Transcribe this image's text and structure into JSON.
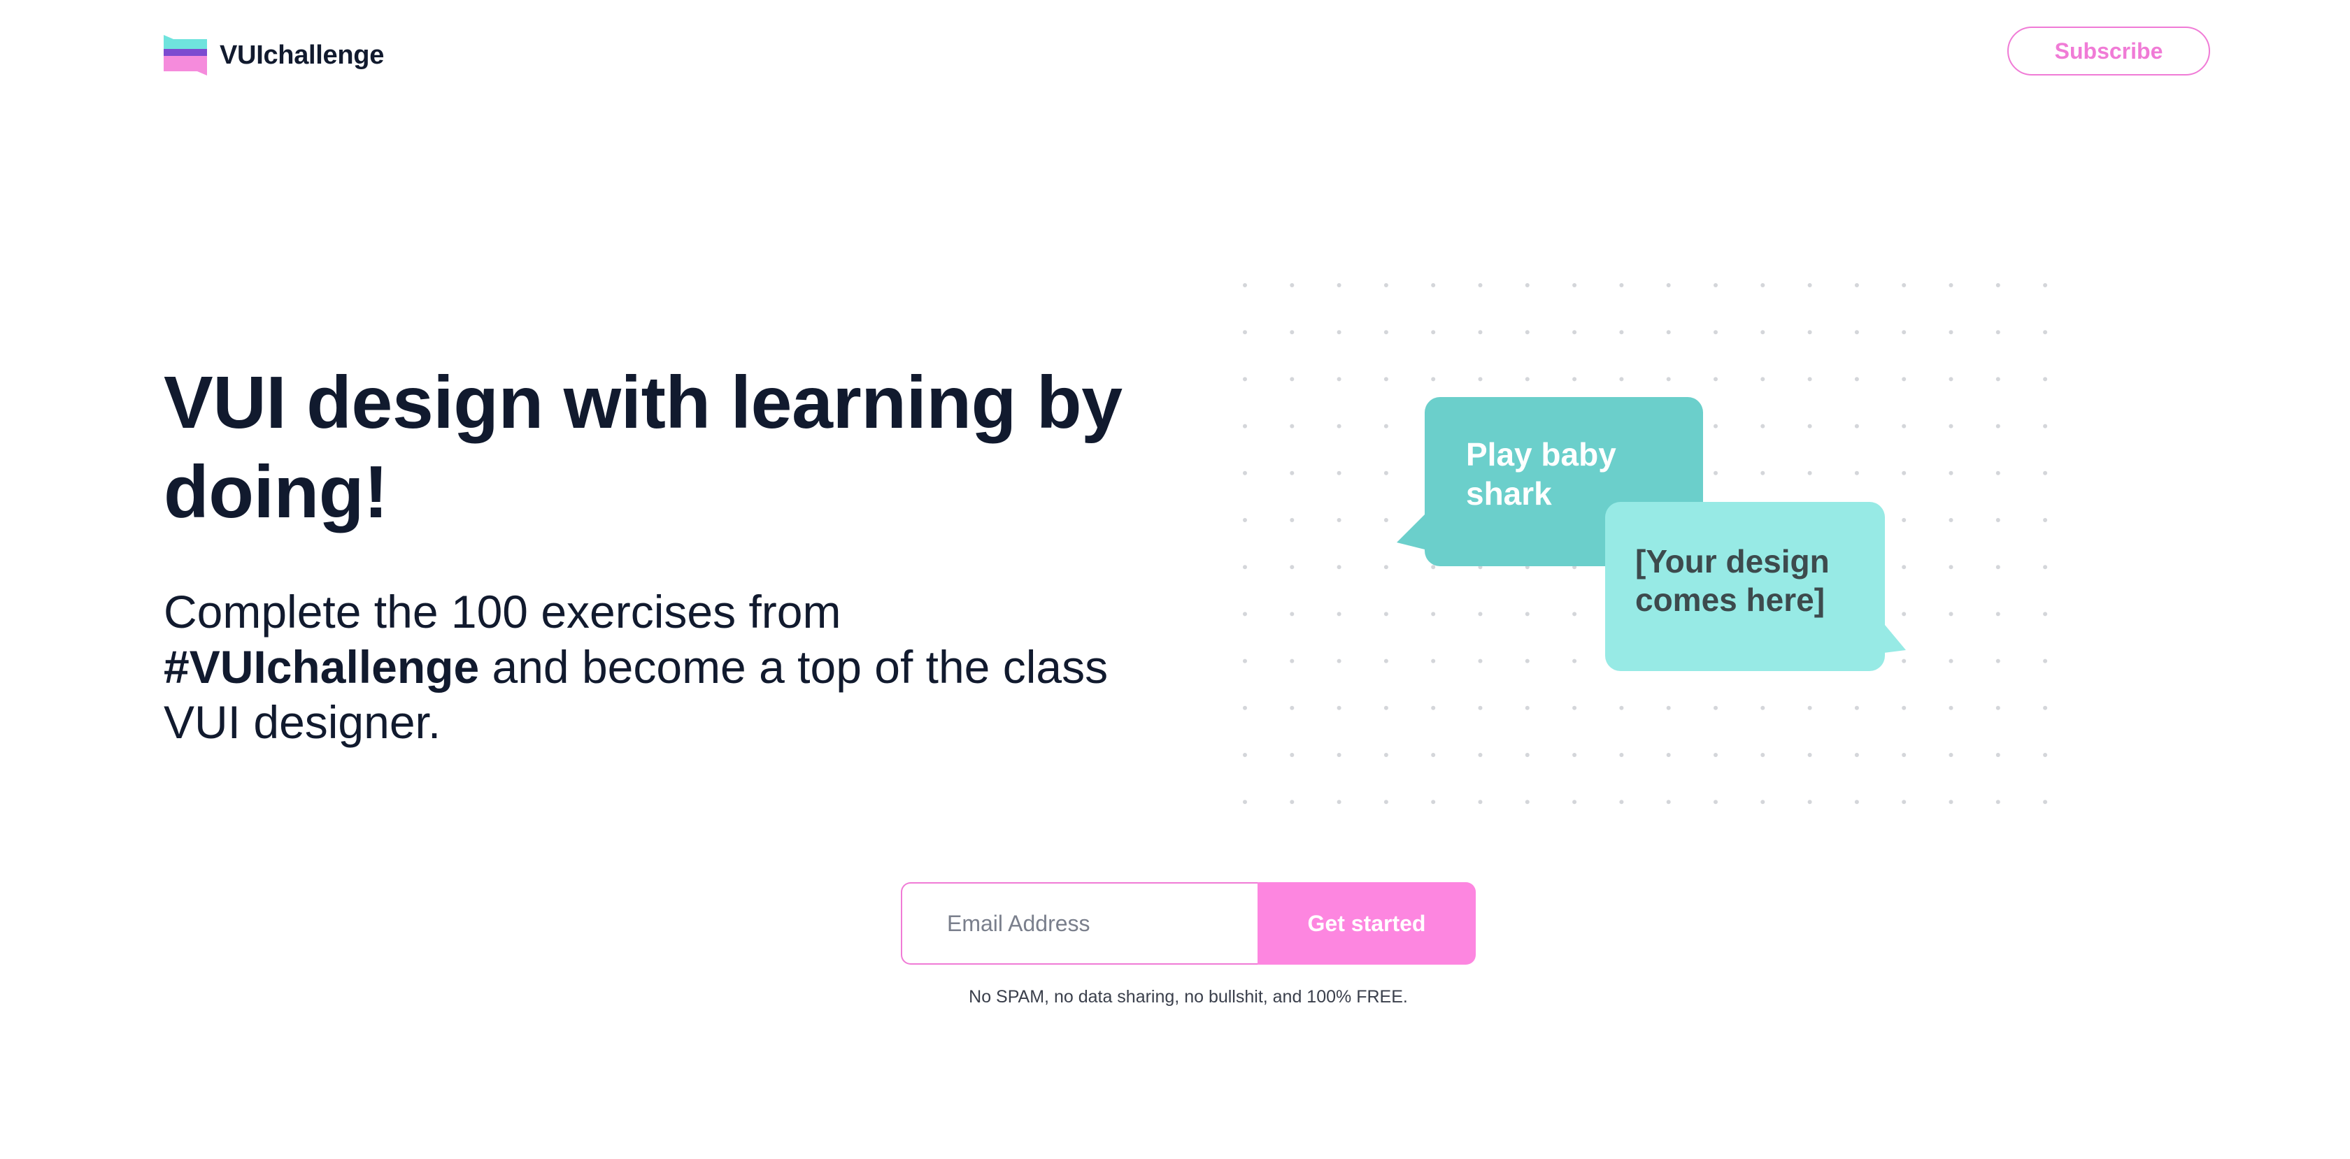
{
  "header": {
    "brand": "VUIchallenge",
    "subscribe_label": "Subscribe"
  },
  "hero": {
    "title": "VUI design with learning by doing!",
    "subtitle_before": "Complete the 100 exercises from ",
    "subtitle_bold": "#VUIchallenge",
    "subtitle_after": " and become a top of the class VUI designer."
  },
  "illustration": {
    "bubble_user_line1": "Play baby",
    "bubble_user_line2": "shark",
    "bubble_reply_line1": "[Your design",
    "bubble_reply_line2": "comes here]"
  },
  "signup": {
    "email_placeholder": "Email Address",
    "email_value": "",
    "cta_label": "Get started",
    "disclaimer": "No SPAM, no data sharing, no bullshit, and 100% FREE."
  },
  "colors": {
    "accent_pink": "#fd86e0",
    "pink_outline": "#f07bd6",
    "teal_dark": "#6bcfcb",
    "teal_light": "#97eae5",
    "text_dark": "#111a2e"
  }
}
